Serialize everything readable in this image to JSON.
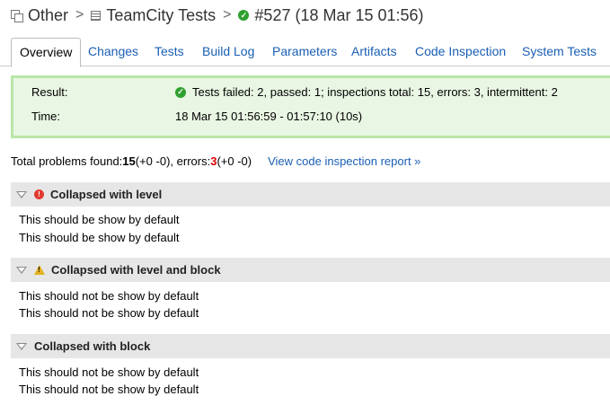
{
  "breadcrumb": {
    "project": "Other",
    "build_type": "TeamCity Tests",
    "build": "#527 (18 Mar 15 01:56)",
    "separator": ">"
  },
  "tabs": [
    "Overview",
    "Changes",
    "Tests",
    "Build Log",
    "Parameters",
    "Artifacts",
    "Code Inspection",
    "System Tests"
  ],
  "active_tab": "Overview",
  "result": {
    "result_label": "Result:",
    "result_value": "Tests failed: 2, passed: 1; inspections total: 15, errors: 3, intermittent: 2",
    "time_label": "Time:",
    "time_value": "18 Mar 15 01:56:59 - 01:57:10 (10s)"
  },
  "summary": {
    "prefix": "Total problems found: ",
    "total": "15",
    "total_delta": " (+0 -0), errors: ",
    "errors": "3",
    "errors_delta": " (+0 -0)",
    "link": "View code inspection report »"
  },
  "sections": [
    {
      "title": "Collapsed with level",
      "icon": "error-icon",
      "lines": [
        "This should be show by default",
        "This should be show by default"
      ]
    },
    {
      "title": "Collapsed with level and block",
      "icon": "warning-icon",
      "lines": [
        "This should not be show by default",
        "This should not be show by default"
      ]
    },
    {
      "title": "Collapsed with block",
      "icon": "",
      "lines": [
        "This should not be show by default",
        "This should not be show by default"
      ]
    }
  ],
  "colors": {
    "link": "#1a5fb4",
    "success": "#2ea02e",
    "result_bg": "#e9f6e3",
    "result_border": "#b9e6a8",
    "error": "#d00000",
    "warning": "#e3b21d"
  }
}
